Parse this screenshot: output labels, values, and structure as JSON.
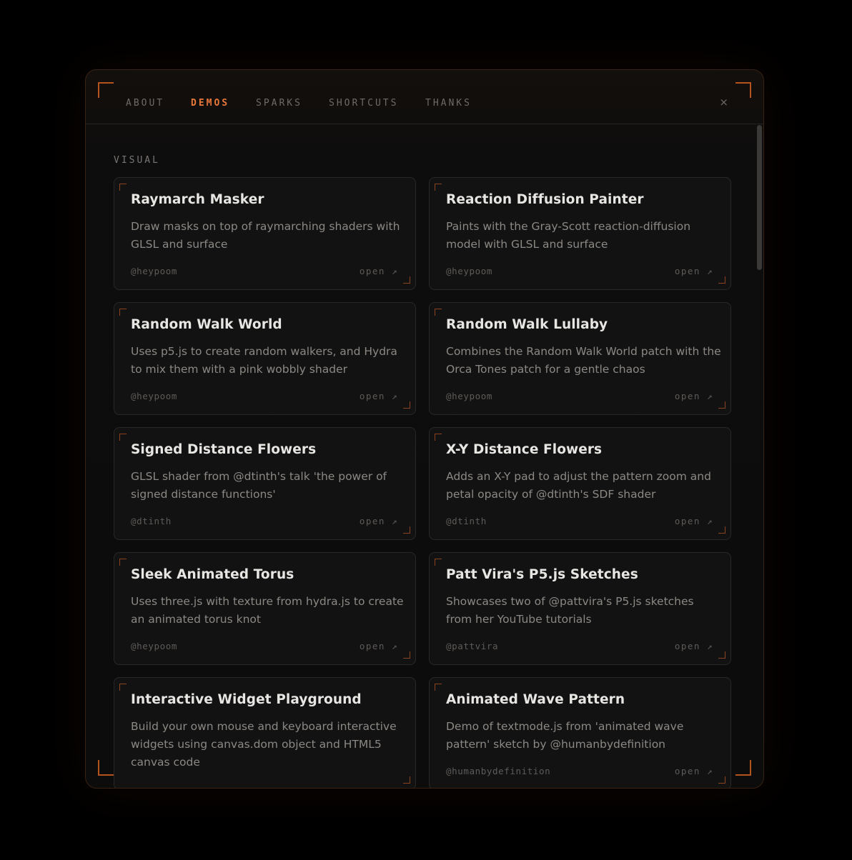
{
  "tabs": [
    {
      "label": "ABOUT",
      "active": false
    },
    {
      "label": "DEMOS",
      "active": true
    },
    {
      "label": "SPARKS",
      "active": false
    },
    {
      "label": "SHORTCUTS",
      "active": false
    },
    {
      "label": "THANKS",
      "active": false
    }
  ],
  "close_label": "×",
  "section": {
    "label": "VISUAL"
  },
  "open_label": "open ↗",
  "demos": [
    {
      "title": "Raymarch Masker",
      "description": "Draw masks on top of raymarching shaders with GLSL and surface",
      "author": "@heypoom"
    },
    {
      "title": "Reaction Diffusion Painter",
      "description": "Paints with the Gray-Scott reaction-diffusion model with GLSL and surface",
      "author": "@heypoom"
    },
    {
      "title": "Random Walk World",
      "description": "Uses p5.js to create random walkers, and Hydra to mix them with a pink wobbly shader",
      "author": "@heypoom"
    },
    {
      "title": "Random Walk Lullaby",
      "description": "Combines the Random Walk World patch with the Orca Tones patch for a gentle chaos",
      "author": "@heypoom"
    },
    {
      "title": "Signed Distance Flowers",
      "description": "GLSL shader from @dtinth's talk 'the power of signed distance functions'",
      "author": "@dtinth"
    },
    {
      "title": "X-Y Distance Flowers",
      "description": "Adds an X-Y pad to adjust the pattern zoom and petal opacity of @dtinth's SDF shader",
      "author": "@dtinth"
    },
    {
      "title": "Sleek Animated Torus",
      "description": "Uses three.js with texture from hydra.js to create an animated torus knot",
      "author": "@heypoom"
    },
    {
      "title": "Patt Vira's P5.js Sketches",
      "description": "Showcases two of @pattvira's P5.js sketches from her YouTube tutorials",
      "author": "@pattvira"
    },
    {
      "title": "Interactive Widget Playground",
      "description": "Build your own mouse and keyboard interactive widgets using canvas.dom object and HTML5 canvas code",
      "author": ""
    },
    {
      "title": "Animated Wave Pattern",
      "description": "Demo of textmode.js from 'animated wave pattern' sketch by @humanbydefinition",
      "author": "@humanbydefinition"
    }
  ],
  "colors": {
    "accent": "#e8773a",
    "corner": "#b5531f",
    "background": "#000000",
    "panel": "#0c0c0d",
    "card": "#121212"
  }
}
